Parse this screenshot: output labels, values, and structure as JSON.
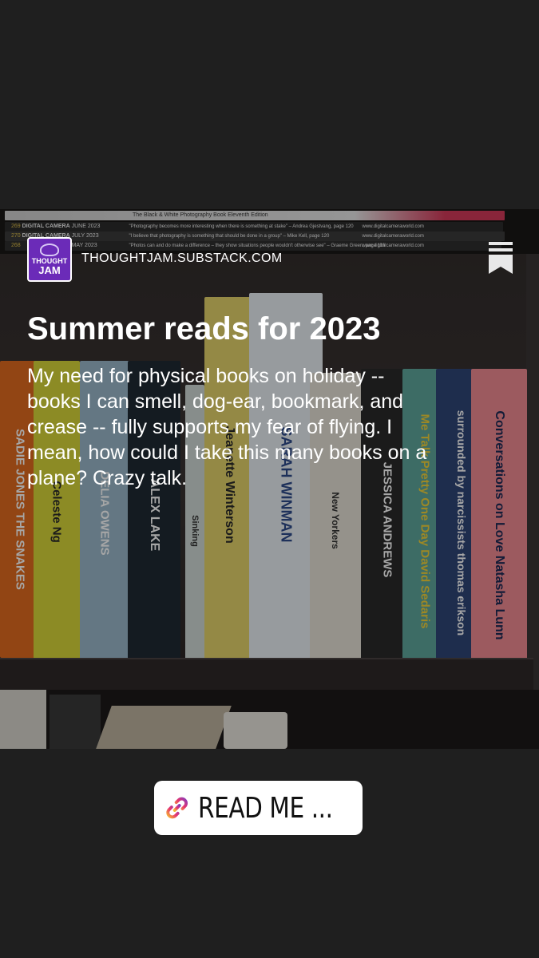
{
  "post": {
    "domain": "THOUGHTJAM.SUBSTACK.COM",
    "logo_line1": "THOUGHT",
    "logo_line2": "JAM",
    "title": "Summer reads for 2023",
    "body": "My need for physical books on holiday -- books I can smell, dog-ear, bookmark, and crease -- fully supports my fear of flying. I mean, how could I take this many books on a plane? Crazy talk."
  },
  "sticker": {
    "label": "READ ME ...",
    "icon": "link-icon"
  },
  "photo": {
    "magazines": [
      {
        "name": "The Black & White Photography Book",
        "date": "Eleventh Edition",
        "quote": "",
        "url": ""
      },
      {
        "number": "269",
        "name": "DIGITAL CAMERA",
        "date": "JUNE 2023",
        "quote": "\"Photography becomes more interesting when there is something at stake\" – Andrea Gjestvang, page 120",
        "url": "www.digitalcameraworld.com"
      },
      {
        "number": "270",
        "name": "DIGITAL CAMERA",
        "date": "JULY 2023",
        "quote": "\"I believe that photography is something that should be done in a group\" – Mike Kell, page 120",
        "url": "www.digitalcameraworld.com"
      },
      {
        "number": "268",
        "name": "",
        "date": "MAY 2023",
        "quote": "\"Photos can and do make a difference – they show situations people wouldn't otherwise see\" – Graeme Green, page 116",
        "url": "www.digitalcameraworld.com"
      }
    ],
    "books": [
      {
        "text": "SADIE JONES  THE SNAKES",
        "color": "#e06a1f",
        "fg": "#ffffff"
      },
      {
        "text": "Celeste Ng",
        "color": "#d7d63a",
        "fg": "#2a2a2a"
      },
      {
        "text": "DELIA OWENS",
        "color": "#9ab7c9",
        "fg": "#ffffff"
      },
      {
        "text": "ALEX LAKE",
        "color": "#1f2a33",
        "fg": "#ffffff"
      },
      {
        "text": "Sinking",
        "color": "#cfd9d6",
        "fg": "#333333"
      },
      {
        "text": "Jeanette Winterson",
        "color": "#e3d36a",
        "fg": "#2a2a2a"
      },
      {
        "text": "SARAH WINMAN",
        "color": "#e9eef3",
        "fg": "#2d4a8a"
      },
      {
        "text": "New Yorkers",
        "color": "#e5e1d6",
        "fg": "#333333"
      },
      {
        "text": "JESSICA ANDREWS",
        "color": "#2a2a2a",
        "fg": "#ffffff"
      },
      {
        "text": "Me Talk Pretty One Day  David Sedaris",
        "color": "#5fa69b",
        "fg": "#f2d23a"
      },
      {
        "text": "surrounded by narcissists  thomas erikson",
        "color": "#2f4677",
        "fg": "#ffffff"
      },
      {
        "text": "Conversations on Love  Natasha Lunn",
        "color": "#f08a92",
        "fg": "#1d2a55"
      }
    ]
  }
}
